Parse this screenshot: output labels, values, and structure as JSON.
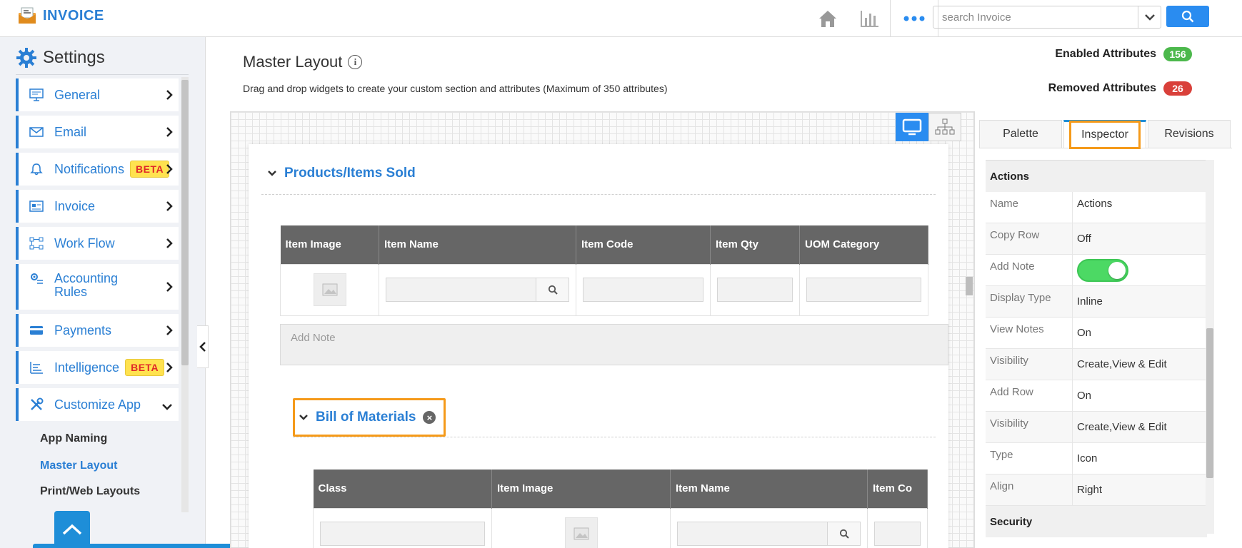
{
  "app": {
    "name": "INVOICE"
  },
  "search": {
    "placeholder": "search Invoice"
  },
  "sidebar": {
    "title": "Settings",
    "items": [
      {
        "label": "General",
        "icon": "monitor-icon"
      },
      {
        "label": "Email",
        "icon": "envelope-icon"
      },
      {
        "label": "Notifications",
        "icon": "bell-icon",
        "badge": "BETA"
      },
      {
        "label": "Invoice",
        "icon": "invoice-icon"
      },
      {
        "label": "Work Flow",
        "icon": "workflow-icon"
      },
      {
        "label_line1": "Accounting",
        "label_line2": "Rules",
        "icon": "gear-rules-icon"
      },
      {
        "label": "Payments",
        "icon": "card-icon"
      },
      {
        "label": "Intelligence",
        "icon": "chart-lines-icon",
        "badge": "BETA"
      },
      {
        "label": "Customize App",
        "icon": "tools-icon"
      }
    ],
    "sub_items": [
      "App Naming",
      "Master Layout",
      "Print/Web Layouts"
    ]
  },
  "main": {
    "title": "Master Layout",
    "subtitle": "Drag and drop widgets to create your custom section and attributes (Maximum of 350 attributes)",
    "enabled_label": "Enabled Attributes",
    "enabled_count": "156",
    "removed_label": "Removed Attributes",
    "removed_count": "26"
  },
  "section1": {
    "title": "Products/Items Sold",
    "columns": [
      "Item Image",
      "Item Name",
      "Item Code",
      "Item Qty",
      "UOM Category"
    ],
    "note_placeholder": "Add Note"
  },
  "section2": {
    "title": "Bill of Materials",
    "columns": [
      "Class",
      "Item Image",
      "Item Name",
      "Item Co"
    ]
  },
  "right_panel": {
    "tabs": [
      "Palette",
      "Inspector",
      "Revisions"
    ],
    "section_header": "Actions",
    "rows": [
      {
        "key": "Name",
        "value": "Actions"
      },
      {
        "key": "Copy Row",
        "value": "Off"
      },
      {
        "key": "Add Note",
        "value": ""
      },
      {
        "key": "Display Type",
        "value": "Inline"
      },
      {
        "key": "View Notes",
        "value": "On"
      },
      {
        "key": "Visibility",
        "value": "Create,View & Edit"
      },
      {
        "key": "Add Row",
        "value": "On"
      },
      {
        "key": "Visibility",
        "value": "Create,View & Edit"
      },
      {
        "key": "Type",
        "value": "Icon"
      },
      {
        "key": "Align",
        "value": "Right"
      }
    ],
    "footer_header": "Security",
    "add_note_toggle": "on"
  },
  "colors": {
    "accent": "#2a7fd4",
    "highlight": "#f59a1a",
    "beta_bg": "#ffe24f",
    "beta_text": "#e02828"
  }
}
